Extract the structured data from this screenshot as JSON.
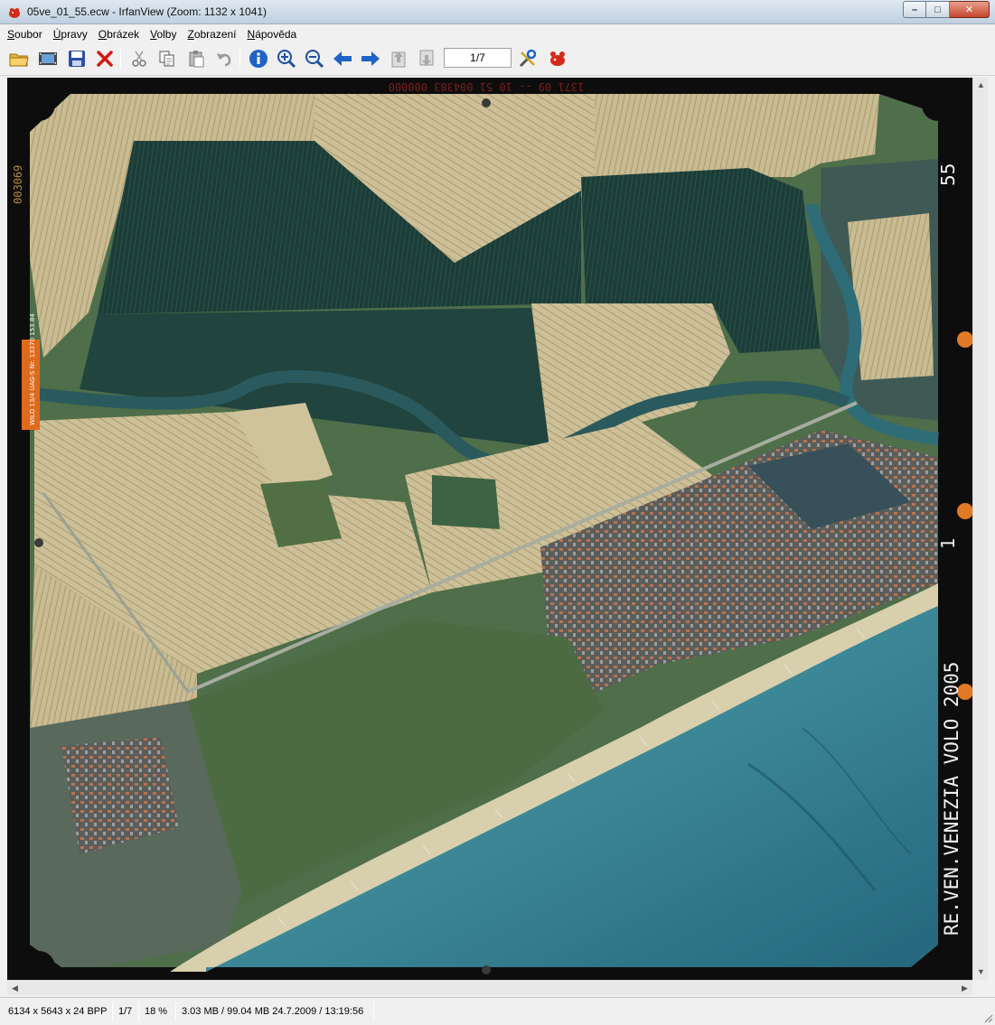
{
  "window": {
    "title": "05ve_01_55.ecw - IrfanView (Zoom: 1132 x 1041)",
    "buttons": {
      "minimize": "–",
      "maximize": "□",
      "close": "✕"
    }
  },
  "menu": [
    {
      "acc": "S",
      "rest": "oubor"
    },
    {
      "acc": "Ú",
      "rest": "pravy"
    },
    {
      "acc": "O",
      "rest": "brázek"
    },
    {
      "acc": "V",
      "rest": "olby"
    },
    {
      "acc": "Z",
      "rest": "obrazení"
    },
    {
      "acc": "N",
      "rest": "ápověda"
    }
  ],
  "toolbar": {
    "page_indicator": "1/7",
    "icons": [
      "open-folder-icon",
      "slideshow-icon",
      "save-icon",
      "delete-icon",
      "cut-icon",
      "copy-icon",
      "paste-icon",
      "undo-icon",
      "info-icon",
      "zoom-in-icon",
      "zoom-out-icon",
      "previous-icon",
      "next-icon",
      "page-up-icon",
      "page-down-icon",
      "settings-icon",
      "irfanview-icon"
    ]
  },
  "photo": {
    "frame_numbers_top": "1371  09  --  10 51  004383  000000",
    "frame_code_left": "003069",
    "frame_number_right": "55",
    "marker_right": "1",
    "caption": "RE.VEN.VENEZIA VOLO 2005",
    "label_left": "WILD 13/4 UAG-S Nr. 13370 153.84"
  },
  "status": {
    "dimensions": "6134 x 5643 x 24 BPP",
    "page": "1/7",
    "zoom": "18 %",
    "memory_date": "3.03 MB / 99.04 MB 24.7.2009 / 13:19:56"
  },
  "colors": {
    "sea": "#2f6f86",
    "dark_field": "#1d3f3a",
    "wheat_field": "#c2b48a",
    "film_border": "#0d0d0d"
  }
}
